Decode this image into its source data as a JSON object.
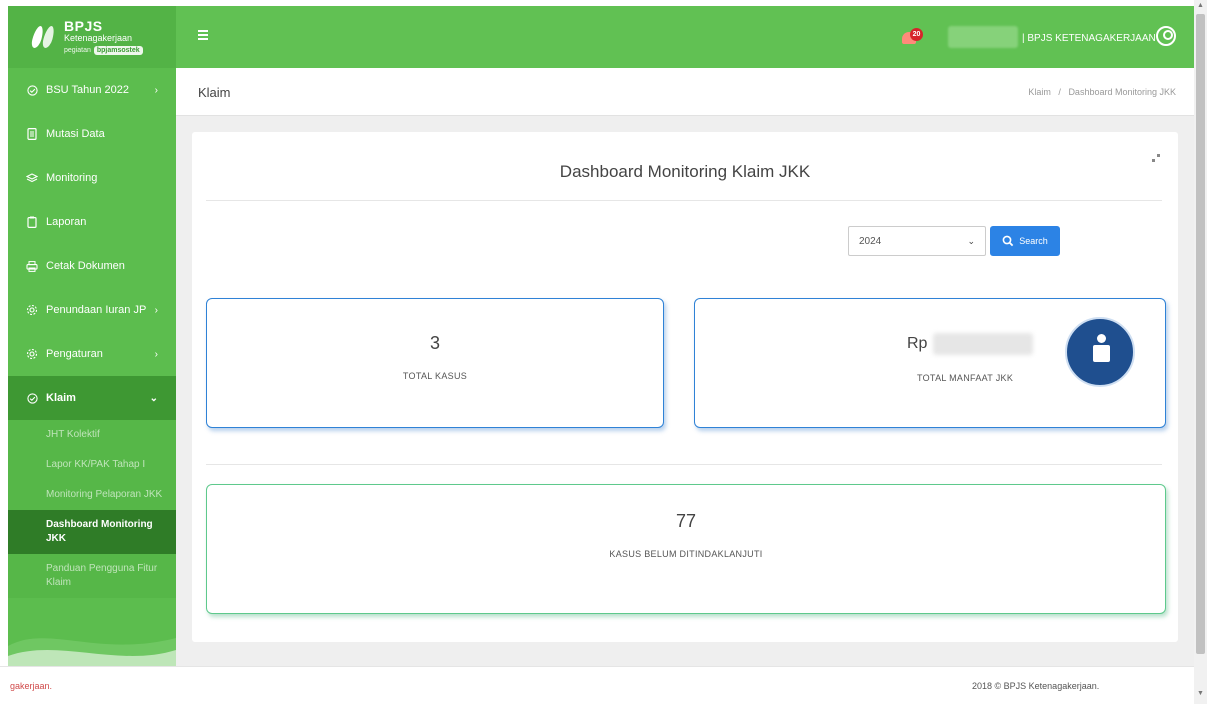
{
  "brand": {
    "name": "BPJS",
    "sub": "Ketenagakerjaan",
    "tag_prefix": "pegiatan",
    "tag": "bpjamsostek"
  },
  "sidebar": {
    "items": [
      {
        "label": "BSU Tahun 2022",
        "icon": "check-circle-icon",
        "chevron": "›"
      },
      {
        "label": "Mutasi Data",
        "icon": "document-icon",
        "chevron": ""
      },
      {
        "label": "Monitoring",
        "icon": "layers-icon",
        "chevron": ""
      },
      {
        "label": "Laporan",
        "icon": "clipboard-icon",
        "chevron": ""
      },
      {
        "label": "Cetak Dokumen",
        "icon": "printer-icon",
        "chevron": ""
      },
      {
        "label": "Penundaan Iuran JP",
        "icon": "gear-icon",
        "chevron": "›"
      },
      {
        "label": "Pengaturan",
        "icon": "gear-icon",
        "chevron": "›"
      },
      {
        "label": "Klaim",
        "icon": "check-circle-icon",
        "chevron": "⌄"
      }
    ],
    "submenu": [
      "JHT Kolektif",
      "Lapor KK/PAK Tahap I",
      "Monitoring Pelaporan JKK",
      "Dashboard Monitoring JKK",
      "Panduan Pengguna Fitur Klaim"
    ]
  },
  "topbar": {
    "notification_count": "20",
    "user_label": "| BPJS KETENAGAKERJAAN"
  },
  "breadcrumb": {
    "title": "Klaim",
    "path": [
      "Klaim",
      "Dashboard Monitoring JKK"
    ],
    "separator": "/"
  },
  "dashboard": {
    "title": "Dashboard Monitoring Klaim JKK",
    "year_value": "2024",
    "search_label": "Search",
    "total_kasus_value": "3",
    "total_kasus_label": "TOTAL KASUS",
    "currency": "Rp",
    "total_manfaat_label": "TOTAL MANFAAT JKK",
    "belum_value": "77",
    "belum_label": "KASUS BELUM DITINDAKLANJUTI"
  },
  "footer": {
    "left": "gakerjaan.",
    "right": "2018 © BPJS Ketenagakerjaan."
  },
  "colors": {
    "sidebar": "#5cbd4e",
    "topbar": "#61c153",
    "active_item": "#3e9833",
    "active_sub": "#2f7c27",
    "primary_button": "#2c83e5",
    "card_border_blue": "#2f82d6",
    "card_border_green": "#5ec98c"
  }
}
